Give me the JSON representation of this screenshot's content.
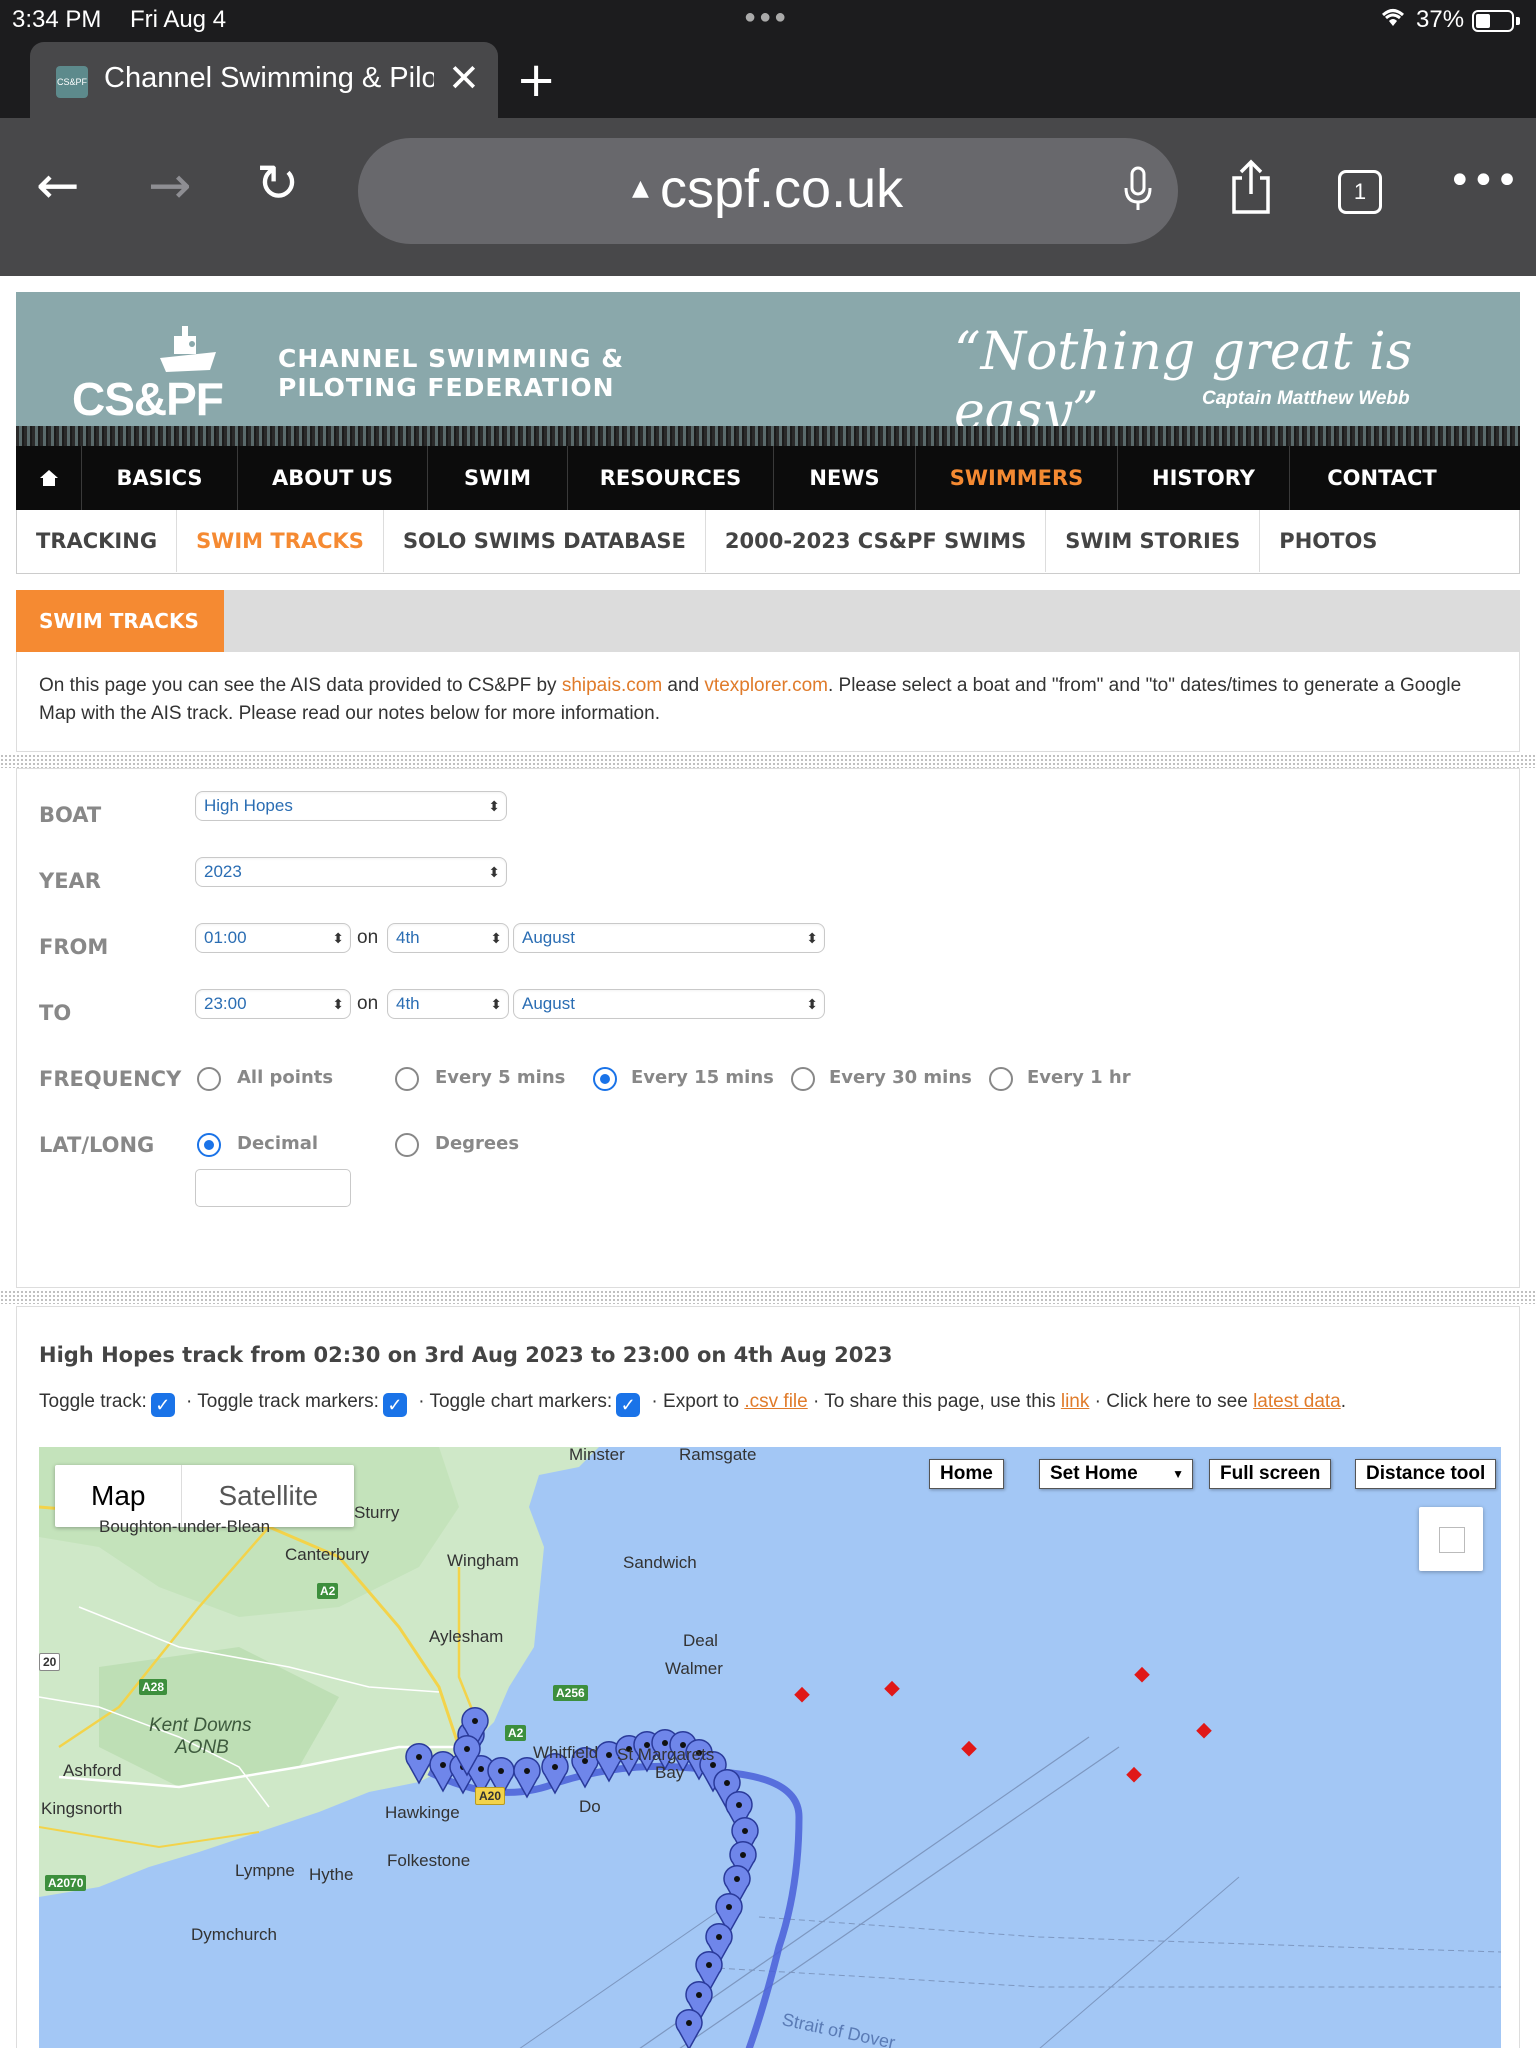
{
  "status": {
    "time": "3:34 PM",
    "date": "Fri Aug 4",
    "battery": "37%"
  },
  "browser": {
    "tab_title": "Channel Swimming & Pilo",
    "favicon_text": "CS&PF",
    "url": "cspf.co.uk",
    "tab_count": "1"
  },
  "site": {
    "logo": "CS&PF",
    "fed_line1": "CHANNEL SWIMMING &",
    "fed_line2": "PILOTING FEDERATION",
    "quote": "“Nothing great is easy”",
    "quote_by": "Captain Matthew Webb",
    "main_nav": [
      "BASICS",
      "ABOUT US",
      "SWIM",
      "RESOURCES",
      "NEWS",
      "SWIMMERS",
      "HISTORY",
      "CONTACT"
    ],
    "main_nav_active": "SWIMMERS",
    "sub_nav": [
      "TRACKING",
      "SWIM TRACKS",
      "SOLO SWIMS DATABASE",
      "2000-2023 CS&PF SWIMS",
      "SWIM STORIES",
      "PHOTOS"
    ],
    "sub_nav_active": "SWIM TRACKS"
  },
  "section": {
    "title": "SWIM TRACKS",
    "intro_1": "On this page you can see the AIS data provided to CS&PF by ",
    "link_1": "shipais.com",
    "intro_2": " and ",
    "link_2": "vtexplorer.com",
    "intro_3": ". Please select a boat and \"from\" and \"to\" dates/times to generate a Google Map with the AIS track. Please read our notes below for more information."
  },
  "form": {
    "boat_label": "BOAT",
    "boat": "High Hopes",
    "year_label": "YEAR",
    "year": "2023",
    "from_label": "FROM",
    "from_time": "01:00",
    "from_day": "4th",
    "from_month": "August",
    "to_label": "TO",
    "to_time": "23:00",
    "to_day": "4th",
    "to_month": "August",
    "on": "on",
    "frequency_label": "FREQUENCY",
    "frequency_options": [
      "All points",
      "Every 5 mins",
      "Every 15 mins",
      "Every 30 mins",
      "Every 1 hr"
    ],
    "frequency_selected": "Every 15 mins",
    "latlong_label": "LAT/LONG",
    "latlong_options": [
      "Decimal",
      "Degrees"
    ],
    "latlong_selected": "Decimal"
  },
  "results": {
    "title": "High Hopes track from 02:30 on 3rd Aug 2023 to 23:00 on 4th Aug 2023",
    "toggle_track": "Toggle track:",
    "toggle_markers": "· Toggle track markers:",
    "toggle_chart": "· Toggle chart markers:",
    "export_text": "· Export to",
    "export_link": ".csv file",
    "share_text": "· To share this page, use this",
    "share_link": "link",
    "latest_text": "· Click here to see",
    "latest_link": "latest data",
    "period": "."
  },
  "map": {
    "type_map": "Map",
    "type_satellite": "Satellite",
    "btn_home": "Home",
    "btn_set_home": "Set Home",
    "btn_fullscreen": "Full screen",
    "btn_distance": "Distance tool",
    "places": [
      "Minster",
      "Ramsgate",
      "Sturry",
      "Boughton-under-Blean",
      "Canterbury",
      "Wingham",
      "Sandwich",
      "Aylesham",
      "Deal",
      "Walmer",
      "Whitfield",
      "St Margarets",
      "Bay",
      "Ashford",
      "Kingsnorth",
      "Hawkinge",
      "Folkestone",
      "Lympne",
      "Hythe",
      "Dymchurch",
      "Do"
    ],
    "aonb_1": "Kent Downs",
    "aonb_2": "AONB",
    "sea_label": "Strait of Dover",
    "roads": [
      "A2",
      "A28",
      "A256",
      "A2",
      "A20",
      "A2070",
      "20"
    ],
    "colors": {
      "sea": "#a3c7f5",
      "land": "#cfe8c8",
      "track": "#4a5fd8",
      "marker": "#e01818"
    }
  }
}
